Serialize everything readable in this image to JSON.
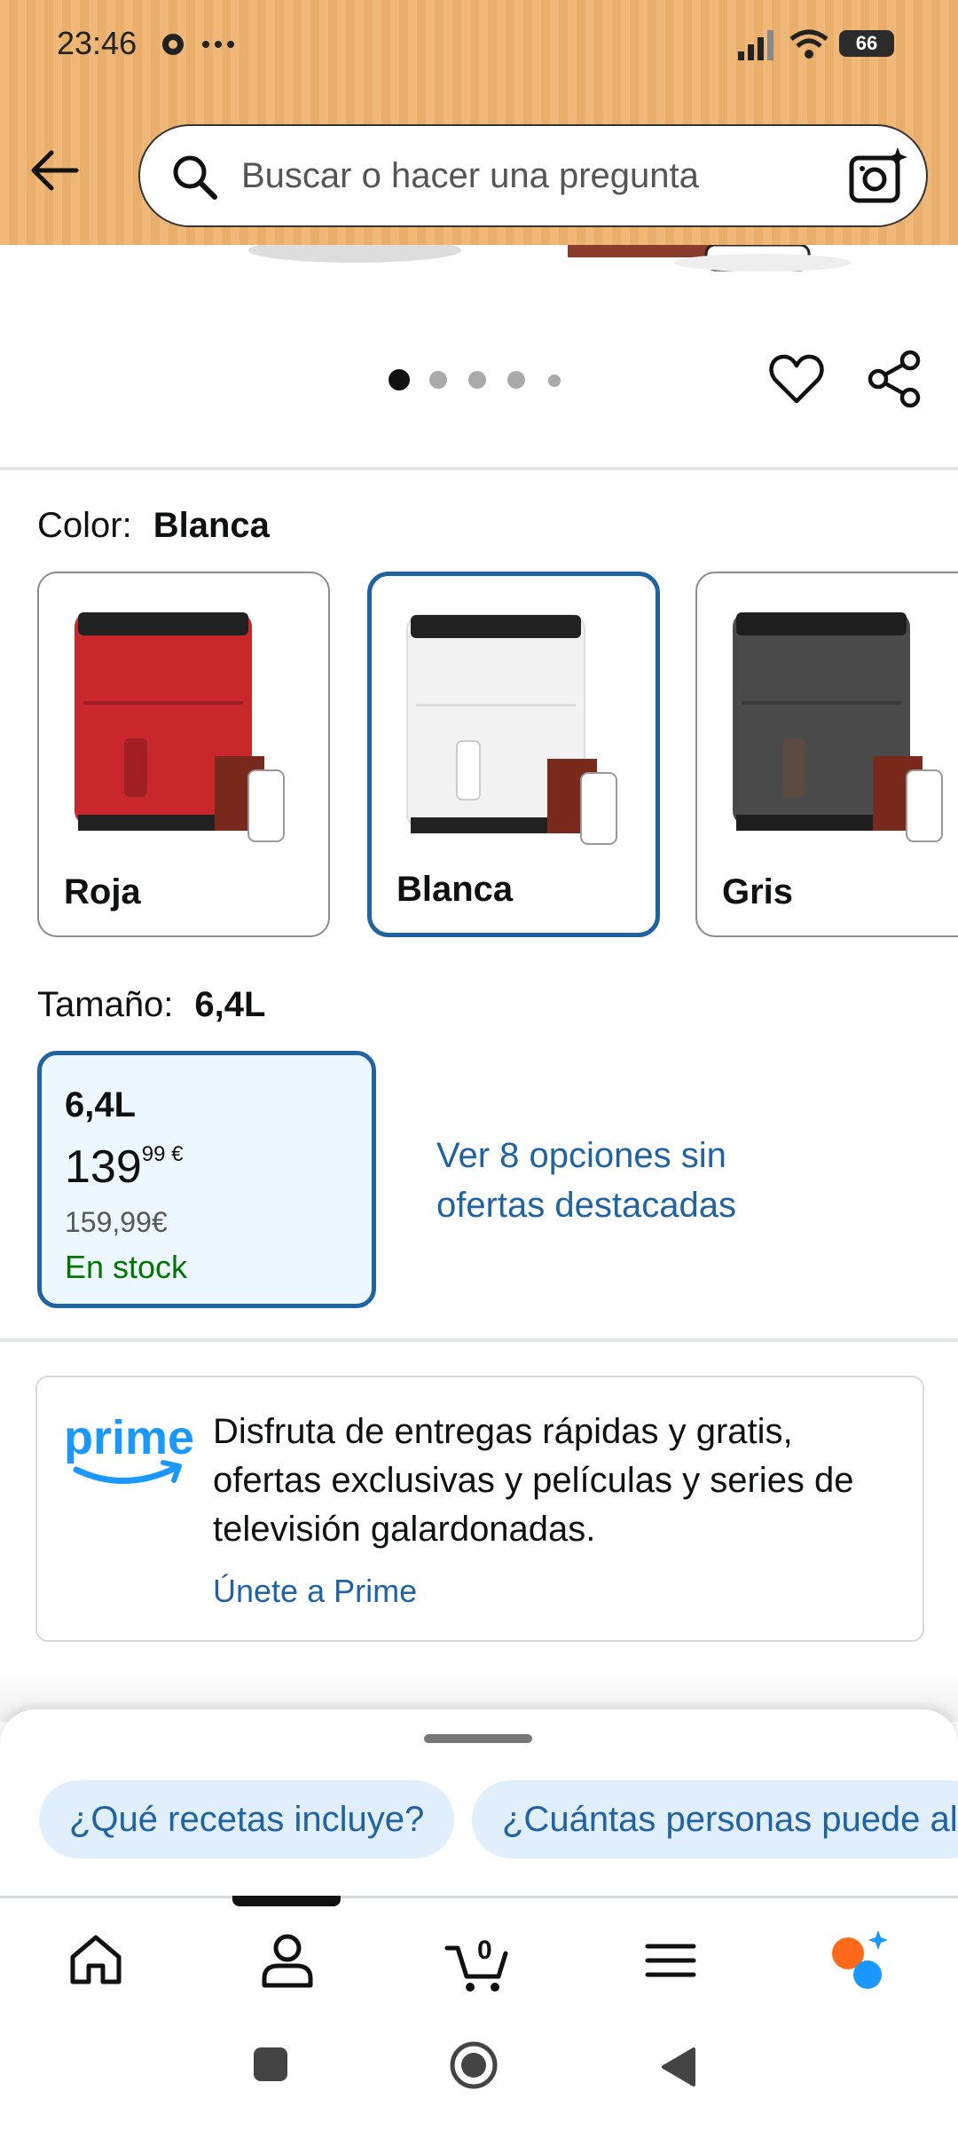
{
  "status_bar": {
    "time": "23:46",
    "battery": "66"
  },
  "search": {
    "placeholder": "Buscar o hacer una pregunta"
  },
  "gallery": {
    "dots_total": 5,
    "active_dot": 1
  },
  "color_selector": {
    "label": "Color:",
    "selected": "Blanca",
    "options": [
      {
        "name": "Roja",
        "color": "#c8282c"
      },
      {
        "name": "Blanca",
        "color": "#f2f2f2"
      },
      {
        "name": "Gris",
        "color": "#4a4a4a"
      }
    ]
  },
  "size_selector": {
    "label": "Tamaño:",
    "selected": "6,4L",
    "option": {
      "name": "6,4L",
      "price_whole": "139",
      "price_fraction": "99 €",
      "old_price": "159,99€",
      "stock": "En stock"
    },
    "more_options_link": "Ver 8 opciones sin ofertas destacadas"
  },
  "prime": {
    "logo_text": "prime",
    "description": "Disfruta de entregas rápidas y gratis, ofertas exclusivas y películas y series de televisión galardonadas.",
    "link": "Únete a Prime"
  },
  "suggestions": [
    "¿Qué recetas incluye?",
    "¿Cuántas personas puede al"
  ],
  "bottom_nav": {
    "items": [
      "home-icon",
      "account-icon",
      "cart-icon",
      "menu-icon",
      "rufus-icon"
    ],
    "cart_count": "0"
  },
  "colors": {
    "accent": "#2162a1",
    "prime_blue": "#1a98ff",
    "stock_green": "#007600",
    "header": "#f0b878"
  }
}
